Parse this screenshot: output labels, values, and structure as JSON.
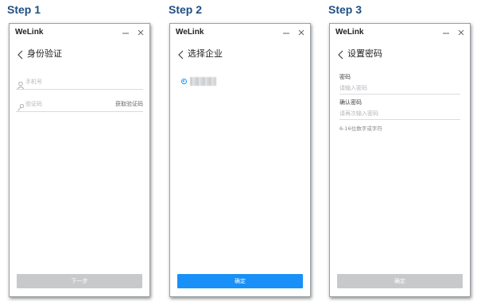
{
  "steps": [
    {
      "label": "Step 1",
      "app_name": "WeLink",
      "title": "身份验证",
      "fields": [
        {
          "placeholder": "手机号",
          "icon": "user-icon"
        },
        {
          "placeholder": "验证码",
          "icon": "key-icon",
          "action": "获取验证码"
        }
      ],
      "button": "下一步",
      "button_state": "disabled"
    },
    {
      "label": "Step 2",
      "app_name": "WeLink",
      "title": "选择企业",
      "options": [
        {
          "selected": true,
          "text_blurred": true
        }
      ],
      "button": "确定",
      "button_state": "primary"
    },
    {
      "label": "Step 3",
      "app_name": "WeLink",
      "title": "设置密码",
      "fields": [
        {
          "label": "密码",
          "placeholder": "请输入密码"
        },
        {
          "label": "确认密码",
          "placeholder": "请再次输入密码"
        }
      ],
      "hint": "6-16位数字或字符",
      "button": "确定",
      "button_state": "disabled"
    }
  ],
  "colors": {
    "step_title": "#1f4f82",
    "primary_button": "#1890f8",
    "disabled_button": "#c8c9ca",
    "border": "#9aa0a6"
  }
}
